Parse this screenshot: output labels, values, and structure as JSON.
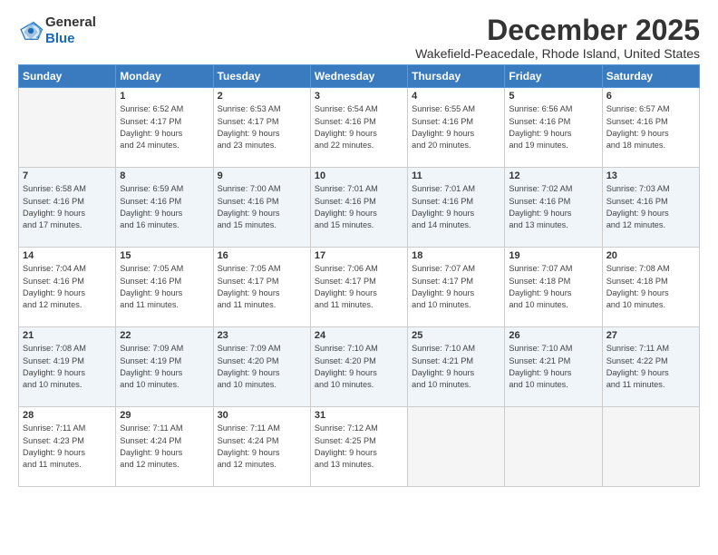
{
  "header": {
    "logo_line1": "General",
    "logo_line2": "Blue",
    "month": "December 2025",
    "location": "Wakefield-Peacedale, Rhode Island, United States"
  },
  "days_of_week": [
    "Sunday",
    "Monday",
    "Tuesday",
    "Wednesday",
    "Thursday",
    "Friday",
    "Saturday"
  ],
  "weeks": [
    [
      {
        "num": "",
        "info": ""
      },
      {
        "num": "1",
        "info": "Sunrise: 6:52 AM\nSunset: 4:17 PM\nDaylight: 9 hours\nand 24 minutes."
      },
      {
        "num": "2",
        "info": "Sunrise: 6:53 AM\nSunset: 4:17 PM\nDaylight: 9 hours\nand 23 minutes."
      },
      {
        "num": "3",
        "info": "Sunrise: 6:54 AM\nSunset: 4:16 PM\nDaylight: 9 hours\nand 22 minutes."
      },
      {
        "num": "4",
        "info": "Sunrise: 6:55 AM\nSunset: 4:16 PM\nDaylight: 9 hours\nand 20 minutes."
      },
      {
        "num": "5",
        "info": "Sunrise: 6:56 AM\nSunset: 4:16 PM\nDaylight: 9 hours\nand 19 minutes."
      },
      {
        "num": "6",
        "info": "Sunrise: 6:57 AM\nSunset: 4:16 PM\nDaylight: 9 hours\nand 18 minutes."
      }
    ],
    [
      {
        "num": "7",
        "info": "Sunrise: 6:58 AM\nSunset: 4:16 PM\nDaylight: 9 hours\nand 17 minutes."
      },
      {
        "num": "8",
        "info": "Sunrise: 6:59 AM\nSunset: 4:16 PM\nDaylight: 9 hours\nand 16 minutes."
      },
      {
        "num": "9",
        "info": "Sunrise: 7:00 AM\nSunset: 4:16 PM\nDaylight: 9 hours\nand 15 minutes."
      },
      {
        "num": "10",
        "info": "Sunrise: 7:01 AM\nSunset: 4:16 PM\nDaylight: 9 hours\nand 15 minutes."
      },
      {
        "num": "11",
        "info": "Sunrise: 7:01 AM\nSunset: 4:16 PM\nDaylight: 9 hours\nand 14 minutes."
      },
      {
        "num": "12",
        "info": "Sunrise: 7:02 AM\nSunset: 4:16 PM\nDaylight: 9 hours\nand 13 minutes."
      },
      {
        "num": "13",
        "info": "Sunrise: 7:03 AM\nSunset: 4:16 PM\nDaylight: 9 hours\nand 12 minutes."
      }
    ],
    [
      {
        "num": "14",
        "info": "Sunrise: 7:04 AM\nSunset: 4:16 PM\nDaylight: 9 hours\nand 12 minutes."
      },
      {
        "num": "15",
        "info": "Sunrise: 7:05 AM\nSunset: 4:16 PM\nDaylight: 9 hours\nand 11 minutes."
      },
      {
        "num": "16",
        "info": "Sunrise: 7:05 AM\nSunset: 4:17 PM\nDaylight: 9 hours\nand 11 minutes."
      },
      {
        "num": "17",
        "info": "Sunrise: 7:06 AM\nSunset: 4:17 PM\nDaylight: 9 hours\nand 11 minutes."
      },
      {
        "num": "18",
        "info": "Sunrise: 7:07 AM\nSunset: 4:17 PM\nDaylight: 9 hours\nand 10 minutes."
      },
      {
        "num": "19",
        "info": "Sunrise: 7:07 AM\nSunset: 4:18 PM\nDaylight: 9 hours\nand 10 minutes."
      },
      {
        "num": "20",
        "info": "Sunrise: 7:08 AM\nSunset: 4:18 PM\nDaylight: 9 hours\nand 10 minutes."
      }
    ],
    [
      {
        "num": "21",
        "info": "Sunrise: 7:08 AM\nSunset: 4:19 PM\nDaylight: 9 hours\nand 10 minutes."
      },
      {
        "num": "22",
        "info": "Sunrise: 7:09 AM\nSunset: 4:19 PM\nDaylight: 9 hours\nand 10 minutes."
      },
      {
        "num": "23",
        "info": "Sunrise: 7:09 AM\nSunset: 4:20 PM\nDaylight: 9 hours\nand 10 minutes."
      },
      {
        "num": "24",
        "info": "Sunrise: 7:10 AM\nSunset: 4:20 PM\nDaylight: 9 hours\nand 10 minutes."
      },
      {
        "num": "25",
        "info": "Sunrise: 7:10 AM\nSunset: 4:21 PM\nDaylight: 9 hours\nand 10 minutes."
      },
      {
        "num": "26",
        "info": "Sunrise: 7:10 AM\nSunset: 4:21 PM\nDaylight: 9 hours\nand 10 minutes."
      },
      {
        "num": "27",
        "info": "Sunrise: 7:11 AM\nSunset: 4:22 PM\nDaylight: 9 hours\nand 11 minutes."
      }
    ],
    [
      {
        "num": "28",
        "info": "Sunrise: 7:11 AM\nSunset: 4:23 PM\nDaylight: 9 hours\nand 11 minutes."
      },
      {
        "num": "29",
        "info": "Sunrise: 7:11 AM\nSunset: 4:24 PM\nDaylight: 9 hours\nand 12 minutes."
      },
      {
        "num": "30",
        "info": "Sunrise: 7:11 AM\nSunset: 4:24 PM\nDaylight: 9 hours\nand 12 minutes."
      },
      {
        "num": "31",
        "info": "Sunrise: 7:12 AM\nSunset: 4:25 PM\nDaylight: 9 hours\nand 13 minutes."
      },
      {
        "num": "",
        "info": ""
      },
      {
        "num": "",
        "info": ""
      },
      {
        "num": "",
        "info": ""
      }
    ]
  ]
}
